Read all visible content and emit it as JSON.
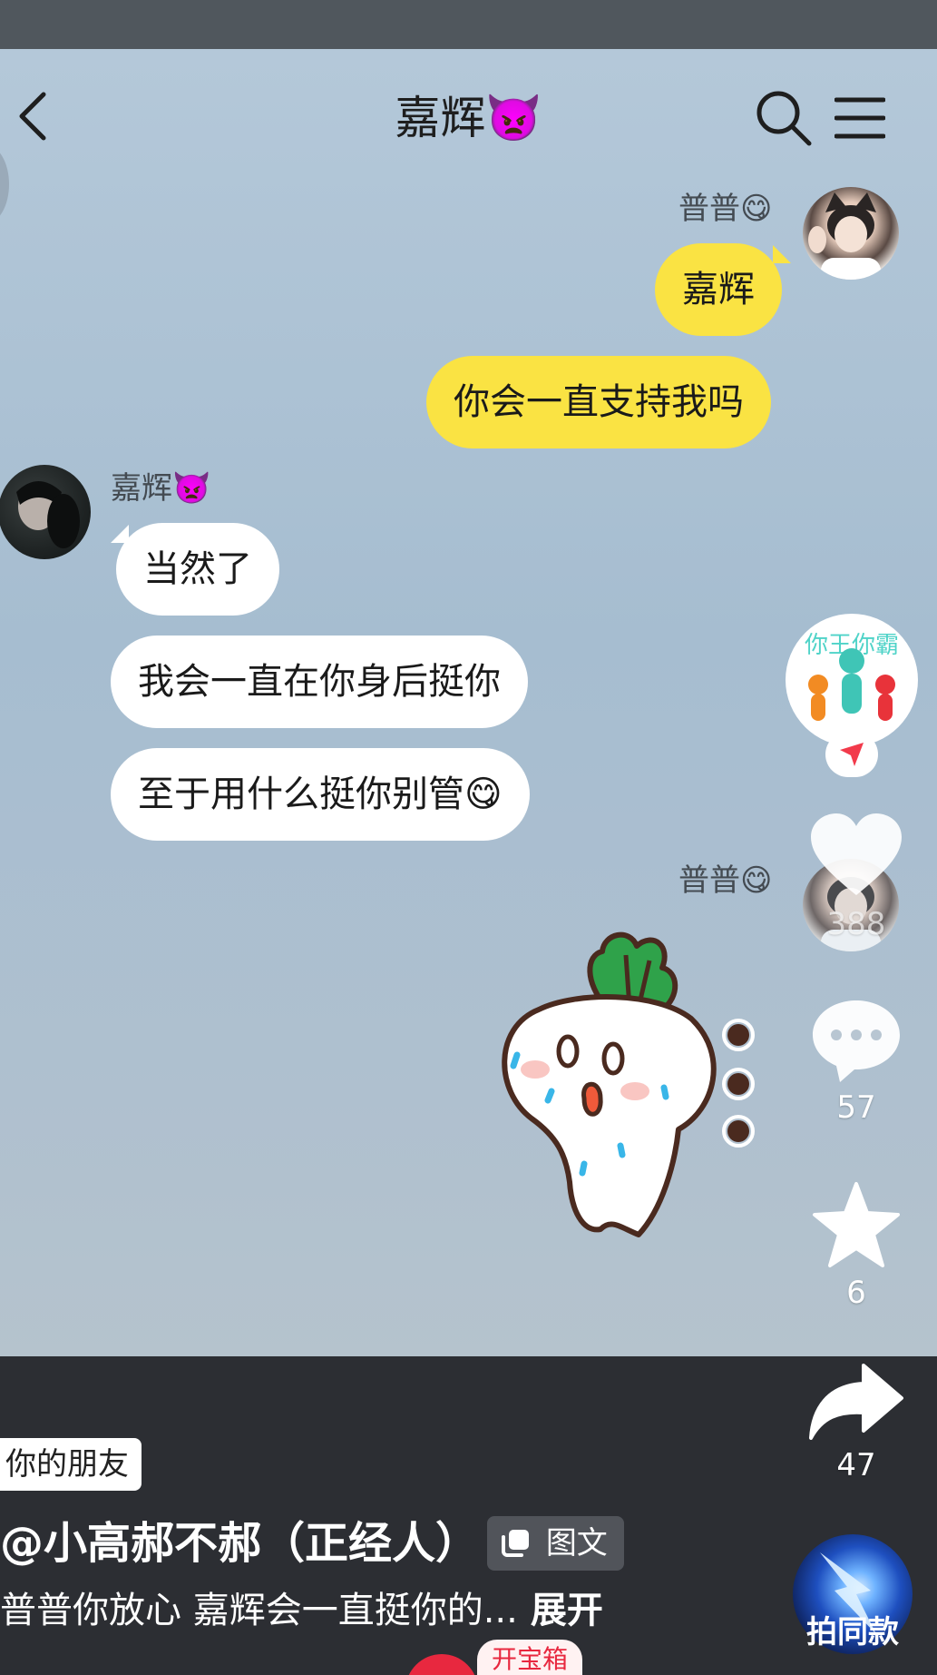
{
  "header": {
    "title": "嘉辉👿"
  },
  "messages": {
    "me_name_1": "普普😋",
    "me_bubble_1": "嘉辉",
    "me_bubble_2": "你会一直支持我吗",
    "other_name": "嘉辉👿",
    "other_bubble_1": "当然了",
    "other_bubble_2": "我会一直在你身后挺你",
    "other_bubble_3": "至于用什么挺你别管😋",
    "me_name_2": "普普😋"
  },
  "sidebar": {
    "profile_badge_text": "你王你霸",
    "likes": "388",
    "comments": "57",
    "favorites": "6",
    "shares": "47",
    "same_style_label": "拍同款"
  },
  "post": {
    "friend_tag": "你的朋友",
    "author": "@小高郝不郝（正经人）",
    "type_badge": "图文",
    "caption": "普普你放心 嘉辉会一直挺你的...",
    "expand_label": "展开",
    "treasure_label": "开宝箱"
  },
  "colors": {
    "my_bubble": "#fae343",
    "other_bubble": "#ffffff",
    "chat_background": "#b4c8d9",
    "bottom_panel": "#2c2e33",
    "accent_red": "#e8283f"
  },
  "icons": [
    "back-icon",
    "search-icon",
    "menu-icon",
    "heart-icon",
    "comment-icon",
    "star-icon",
    "share-icon",
    "send-icon"
  ]
}
